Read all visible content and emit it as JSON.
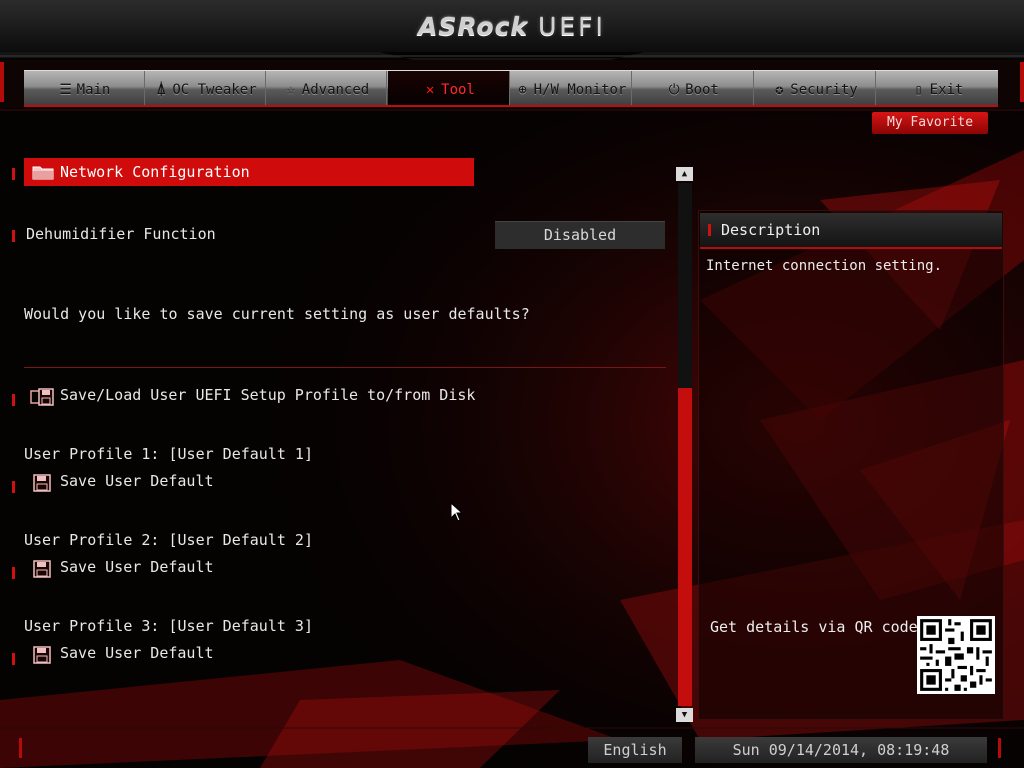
{
  "header": {
    "logo_brand": "ASRock",
    "logo_product": "UEFI"
  },
  "tabs": [
    {
      "label": "Main",
      "icon": "list-icon"
    },
    {
      "label": "OC Tweaker",
      "icon": "rocket-icon"
    },
    {
      "label": "Advanced",
      "icon": "star-icon"
    },
    {
      "label": "Tool",
      "icon": "tool-icon",
      "active": true
    },
    {
      "label": "H/W Monitor",
      "icon": "monitor-icon"
    },
    {
      "label": "Boot",
      "icon": "power-icon"
    },
    {
      "label": "Security",
      "icon": "shield-icon"
    },
    {
      "label": "Exit",
      "icon": "door-icon"
    }
  ],
  "favorite_button": "My Favorite",
  "content": {
    "network_config": "Network Configuration",
    "dehumidifier": {
      "label": "Dehumidifier Function",
      "value": "Disabled"
    },
    "save_question": "Would you like to save current setting as user defaults?",
    "save_load_profile": "Save/Load User UEFI Setup Profile to/from Disk",
    "profiles": [
      {
        "title": "User Profile 1: [User Default 1]",
        "action": "Save User Default"
      },
      {
        "title": "User Profile 2: [User Default 2]",
        "action": "Save User Default"
      },
      {
        "title": "User Profile 3: [User Default 3]",
        "action": "Save User Default"
      }
    ]
  },
  "description": {
    "title": "Description",
    "text": "Internet connection setting.",
    "qr_label": "Get details via QR code"
  },
  "footer": {
    "language": "English",
    "datetime": "Sun 09/14/2014, 08:19:48"
  },
  "colors": {
    "accent": "#d00b0b",
    "background": "#050202"
  }
}
